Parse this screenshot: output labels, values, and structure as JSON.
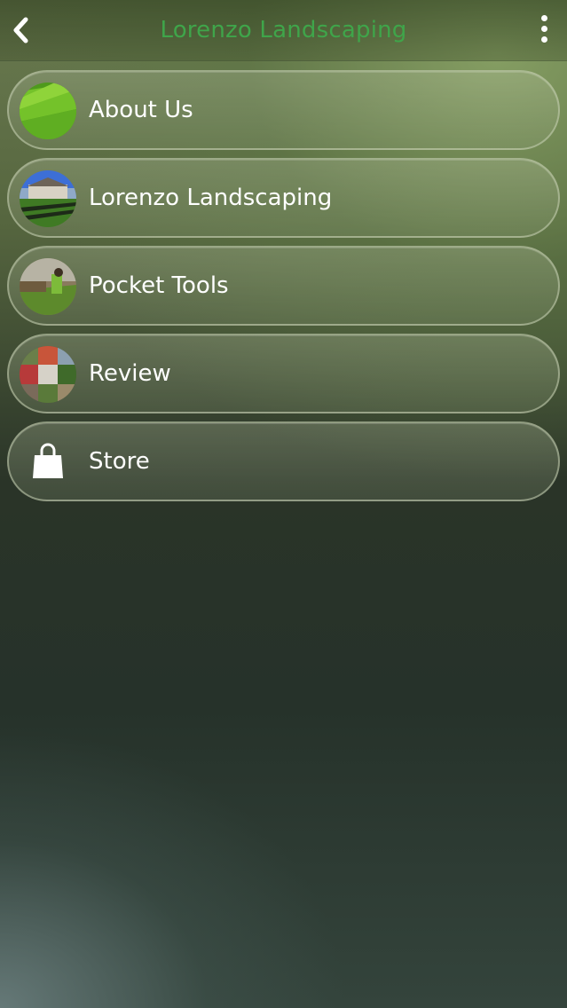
{
  "header": {
    "title": "Lorenzo Landscaping",
    "back_icon": "chevron-left-icon",
    "more_icon": "more-vertical-icon",
    "title_color": "#3fa54a"
  },
  "menu": {
    "items": [
      {
        "label": "About Us",
        "icon": "lawn-photo-thumbnail"
      },
      {
        "label": "Lorenzo Landscaping",
        "icon": "estate-photo-thumbnail"
      },
      {
        "label": "Pocket Tools",
        "icon": "sod-install-photo-thumbnail"
      },
      {
        "label": "Review",
        "icon": "garden-collage-thumbnail"
      },
      {
        "label": "Store",
        "icon": "shopping-bag-icon"
      }
    ]
  }
}
